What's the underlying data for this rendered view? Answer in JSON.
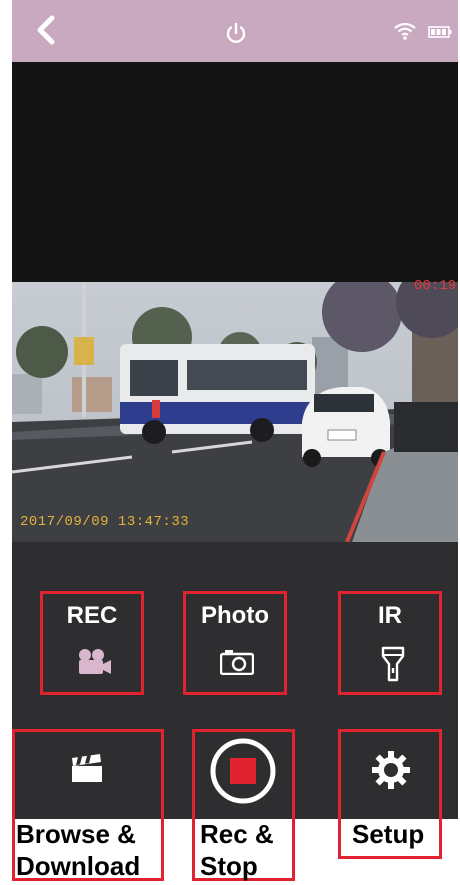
{
  "topbar": {
    "back_icon": "chevron-left-icon",
    "power_icon": "power-icon",
    "wifi_icon": "wifi-icon",
    "battery_icon": "battery-icon",
    "bar_color": "#c9a9bf"
  },
  "video": {
    "rec_time": "00:19",
    "timestamp": "2017/09/09 13:47:33"
  },
  "controls": {
    "rec": {
      "label": "REC",
      "icon": "video-camera-icon"
    },
    "photo": {
      "label": "Photo",
      "icon": "camera-icon"
    },
    "ir": {
      "label": "IR",
      "icon": "flashlight-icon"
    },
    "browse": {
      "icon": "clapperboard-icon",
      "label_line1": "Browse &",
      "label_line2": "Download"
    },
    "recstop": {
      "icon": "record-stop-icon",
      "label_line1": "Rec &",
      "label_line2": "Stop"
    },
    "setup": {
      "icon": "gear-icon",
      "label": "Setup"
    },
    "highlight_color": "#e0232e"
  }
}
